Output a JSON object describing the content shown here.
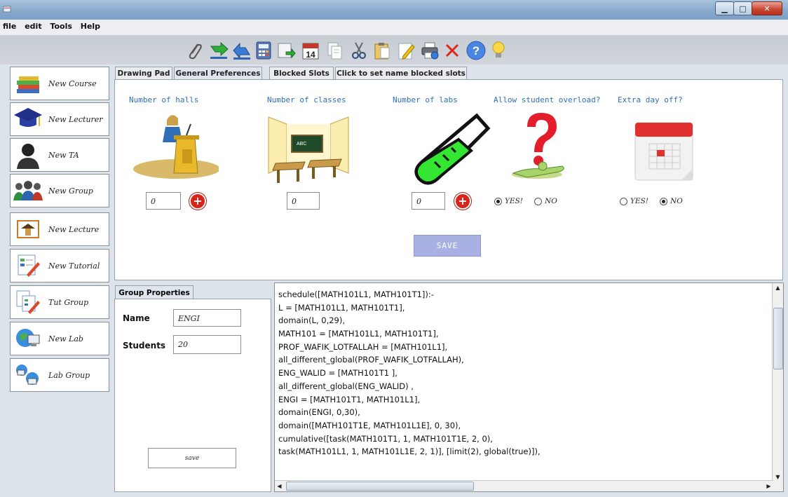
{
  "menu": [
    "file",
    "edit",
    "Tools",
    "Help"
  ],
  "toolbar_icons": [
    "paperclip-icon",
    "import-arrow-icon",
    "export-arrow-icon",
    "calculator-icon",
    "mail-forward-icon",
    "calendar-icon",
    "document-copy-icon",
    "scissors-icon",
    "clipboard-paste-icon",
    "edit-pencil-icon",
    "printer-icon",
    "delete-x-icon",
    "help-icon",
    "lightbulb-icon"
  ],
  "calendar_day": "14",
  "sidebar": [
    {
      "label": "New Course",
      "icon": "books-icon"
    },
    {
      "label": "New Lecturer",
      "icon": "graduation-cap-icon"
    },
    {
      "label": "New TA",
      "icon": "person-silhouette-icon"
    },
    {
      "label": "New Group",
      "icon": "people-group-icon"
    },
    {
      "label": "New Lecture",
      "icon": "lecture-house-icon"
    },
    {
      "label": "New Tutorial",
      "icon": "tutorial-document-icon"
    },
    {
      "label": "Tut Group",
      "icon": "tutorial-group-icon"
    },
    {
      "label": "New Lab",
      "icon": "lab-computer-icon"
    },
    {
      "label": "Lab Group",
      "icon": "lab-group-icon"
    }
  ],
  "tabs": [
    "Drawing Pad",
    "General Preferences",
    "Blocked Slots",
    "Click to set name blocked slots"
  ],
  "prefs": {
    "halls_title": "Number of halls",
    "classes_title": "Number of classes",
    "labs_title": "Number of labs",
    "overload_title": "Allow student overload?",
    "dayoff_title": "Extra day off?",
    "halls_value": "0",
    "classes_value": "0",
    "labs_value": "0",
    "yes_label": "YES!",
    "no_label": "NO",
    "save_label": "SAVE"
  },
  "group_props": {
    "tab": "Group Properties",
    "name_label": "Name",
    "name_value": "ENGI",
    "students_label": "Students",
    "students_value": "20",
    "save_label": "save"
  },
  "code_lines": [
    "schedule([MATH101L1, MATH101T1]):-",
    " L = [MATH101L1, MATH101T1],",
    "domain(L, 0,29),",
    "MATH101 = [MATH101L1, MATH101T1],",
    "PROF_WAFIK_LOTFALLAH = [MATH101L1],",
    "all_different_global(PROF_WAFIK_LOTFALLAH),",
    "ENG_WALID = [MATH101T1 ],",
    " all_different_global(ENG_WALID) ,",
    "ENGI = [MATH101T1, MATH101L1],",
    "domain(ENGI, 0,30),",
    "domain([MATH101T1E, MATH101L1E], 0, 30),",
    "cumulative([task(MATH101T1, 1, MATH101T1E, 2, 0),",
    "task(MATH101L1, 1, MATH101L1E, 2, 1)], [limit(2), global(true)]),"
  ]
}
